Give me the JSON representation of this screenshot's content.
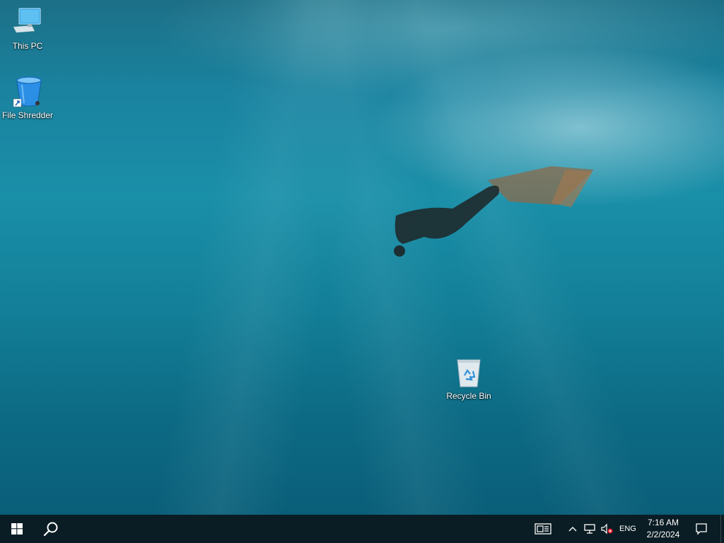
{
  "desktop": {
    "icons": [
      {
        "label": "This PC",
        "icon": "monitor-icon"
      },
      {
        "label": "File Shredder",
        "icon": "blue-bin-icon"
      },
      {
        "label": "Recycle Bin",
        "icon": "recycle-bin-icon"
      }
    ]
  },
  "taskbar": {
    "start_icon": "windows-logo-icon",
    "search_icon": "search-icon",
    "news_icon": "news-widget-icon",
    "tray": {
      "chevron_icon": "chevron-up-icon",
      "network_icon": "network-icon",
      "volume_icon": "volume-muted-icon",
      "language": "ENG",
      "time": "7:16 AM",
      "date": "2/2/2024",
      "notification_icon": "notification-icon"
    }
  },
  "colors": {
    "taskbar_bg": "#0b1d24",
    "water_mid": "#1a8fa8",
    "water_dark": "#0a5e78"
  }
}
